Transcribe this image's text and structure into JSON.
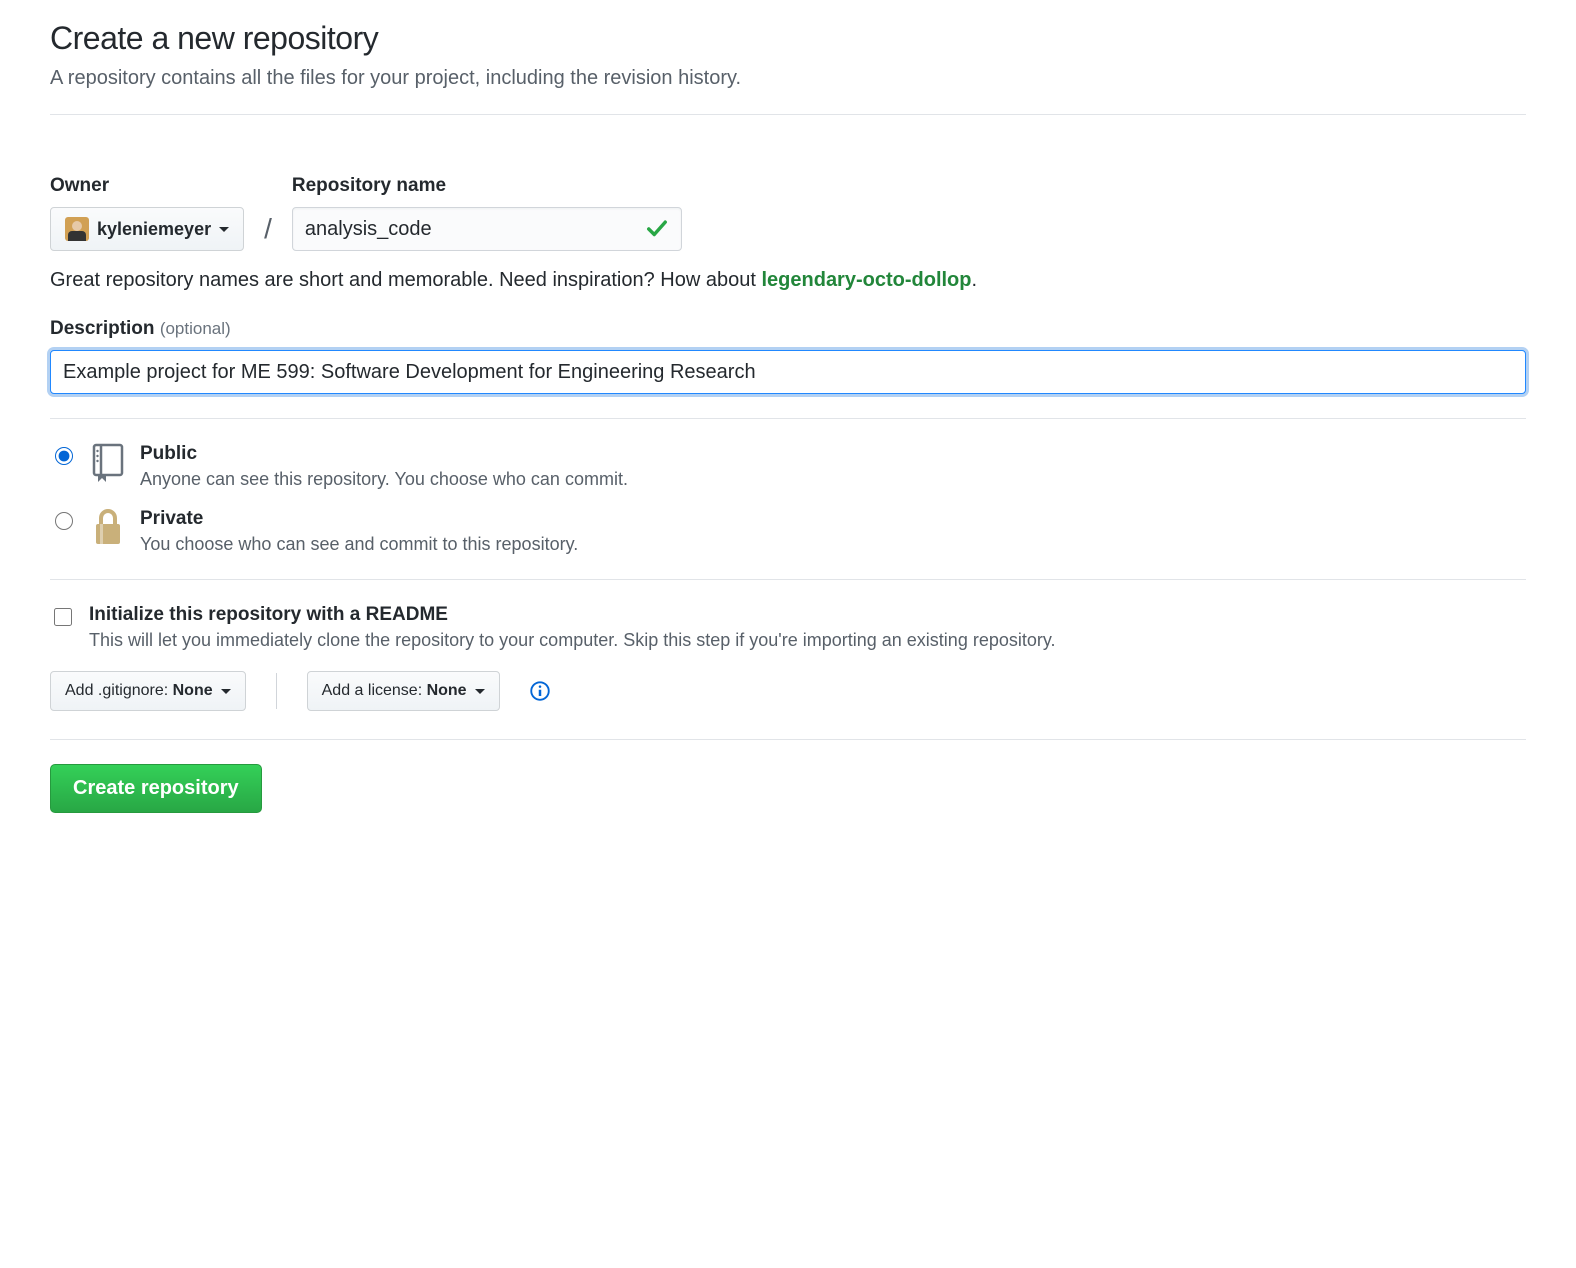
{
  "header": {
    "title": "Create a new repository",
    "subtitle": "A repository contains all the files for your project, including the revision history."
  },
  "owner": {
    "label": "Owner",
    "username": "kyleniemeyer"
  },
  "repo": {
    "label": "Repository name",
    "value": "analysis_code"
  },
  "hint": {
    "prefix": "Great repository names are short and memorable. Need inspiration? How about ",
    "suggestion": "legendary-octo-dollop",
    "suffix": "."
  },
  "description": {
    "label": "Description",
    "optional": "(optional)",
    "value": "Example project for ME 599: Software Development for Engineering Research"
  },
  "visibility": {
    "public": {
      "label": "Public",
      "desc": "Anyone can see this repository. You choose who can commit."
    },
    "private": {
      "label": "Private",
      "desc": "You choose who can see and commit to this repository."
    }
  },
  "readme": {
    "label": "Initialize this repository with a README",
    "desc": "This will let you immediately clone the repository to your computer. Skip this step if you're importing an existing repository."
  },
  "dropdowns": {
    "gitignore_prefix": "Add .gitignore: ",
    "gitignore_value": "None",
    "license_prefix": "Add a license: ",
    "license_value": "None"
  },
  "submit": {
    "label": "Create repository"
  }
}
